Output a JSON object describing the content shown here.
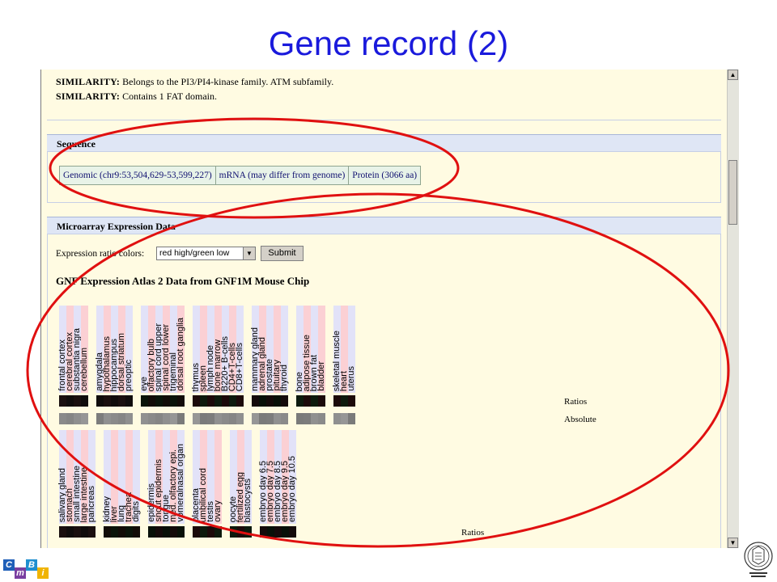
{
  "slide": {
    "title": "Gene record (2)"
  },
  "similarity": [
    {
      "label": "SIMILARITY:",
      "text": "Belongs to the PI3/PI4-kinase family. ATM subfamily."
    },
    {
      "label": "SIMILARITY:",
      "text": "Contains 1 FAT domain."
    }
  ],
  "sequence": {
    "heading": "Sequence",
    "links": [
      "Genomic (chr9:53,504,629-53,599,227)",
      "mRNA (may differ from genome)",
      "Protein (3066 aa)"
    ]
  },
  "microarray": {
    "heading": "Microarray Expression Data",
    "color_label": "Expression ratio colors:",
    "color_selected": "red high/green low",
    "submit_label": "Submit",
    "atlas_title": "GNF Expression Atlas 2 Data from GNF1M Mouse Chip",
    "ratios_label": "Ratios",
    "absolute_label": "Absolute",
    "groups_row1": [
      [
        "frontal cortex",
        "cerebral cortex",
        "substantia nigra",
        "cerebellum"
      ],
      [
        "amygdala",
        "hypothalamus",
        "hippocampus",
        "dorsal striatum",
        "preoptic"
      ],
      [
        "eye",
        "olfactory bulb",
        "spinal cord upper",
        "spinal cord lower",
        "trigeminal",
        "dorsal root ganglia"
      ],
      [
        "thymus",
        "spleen",
        "lymph node",
        "bone marrow",
        "B220+ B-cells",
        "CD4+T-cells",
        "CD8+T-cells"
      ],
      [
        "mammary gland",
        "adrenal gland",
        "prostate",
        "pituitary",
        "thyroid"
      ],
      [
        "bone",
        "adipose tissue",
        "brown fat",
        "bladder"
      ],
      [
        "skeletal muscle",
        "heart",
        "uterus"
      ]
    ],
    "groups_row2": [
      [
        "salivary gland",
        "stomach",
        "small intestine",
        "large intestine",
        "pancreas"
      ],
      [
        "kidney",
        "liver",
        "lung",
        "trachea",
        "digits"
      ],
      [
        "epidermis",
        "snout epidermis",
        "tongue",
        "med. olfactory epi.",
        "vomeralnasal organ"
      ],
      [
        "placenta",
        "umbilical cord",
        "testis",
        "ovary"
      ],
      [
        "oocyte",
        "fertilized egg",
        "blastocysts"
      ],
      [
        "embryo day 6.5",
        "embryo day 7.5",
        "embryo day 8.5",
        "embryo day 9.5",
        "embryo day 10.5"
      ]
    ]
  },
  "colors": {
    "title": "#1a1adc",
    "annotation": "#e01010",
    "panel_header": "#dfe6f5",
    "page_bg": "#fffbe2",
    "label_pink": "#fbd0d4",
    "label_lavender": "#e2e2f8"
  },
  "icons": [
    "scroll-up-arrow-icon",
    "scroll-down-arrow-icon",
    "dropdown-arrow-icon",
    "cmbi-logo",
    "university-seal-logo"
  ],
  "logo": {
    "letters": [
      "C",
      "m",
      "B",
      "i"
    ]
  }
}
